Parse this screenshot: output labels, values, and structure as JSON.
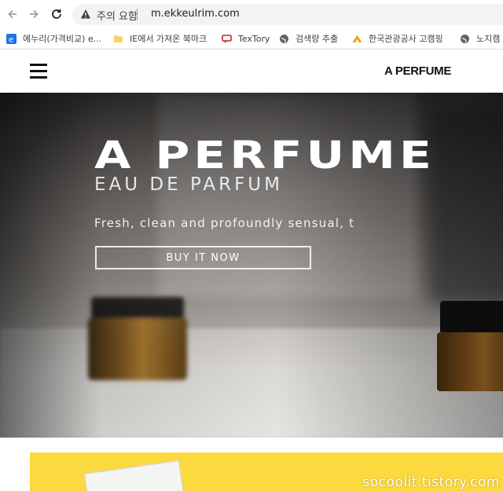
{
  "browser": {
    "security_status": "주의 요함",
    "url": "m.ekkeulrim.com",
    "bookmarks": [
      {
        "label": "에누리(가격비교) e...",
        "icon": "enuri-icon",
        "color": "#1a73e8"
      },
      {
        "label": "IE에서 가져온 북마크",
        "icon": "folder-icon",
        "color": "#f9d35b"
      },
      {
        "label": "TexTory",
        "icon": "textory-icon",
        "color": "#c5221f"
      },
      {
        "label": "검색량 추출",
        "icon": "globe-icon",
        "color": "#5f6368"
      },
      {
        "label": "한국관광공사 고캠핑",
        "icon": "tent-icon",
        "color": "#f29900"
      },
      {
        "label": "노지캠",
        "icon": "globe-icon",
        "color": "#5f6368"
      }
    ]
  },
  "site": {
    "brand": "A PERFUME"
  },
  "hero": {
    "title": "A PERFUME",
    "subtitle": "EAU DE PARFUM",
    "description": "Fresh, clean and profoundly sensual, t",
    "cta_label": "BUY IT NOW"
  },
  "footer": {
    "watermark": "socoolit.tistory.com",
    "banner_color": "#fcd93f"
  }
}
